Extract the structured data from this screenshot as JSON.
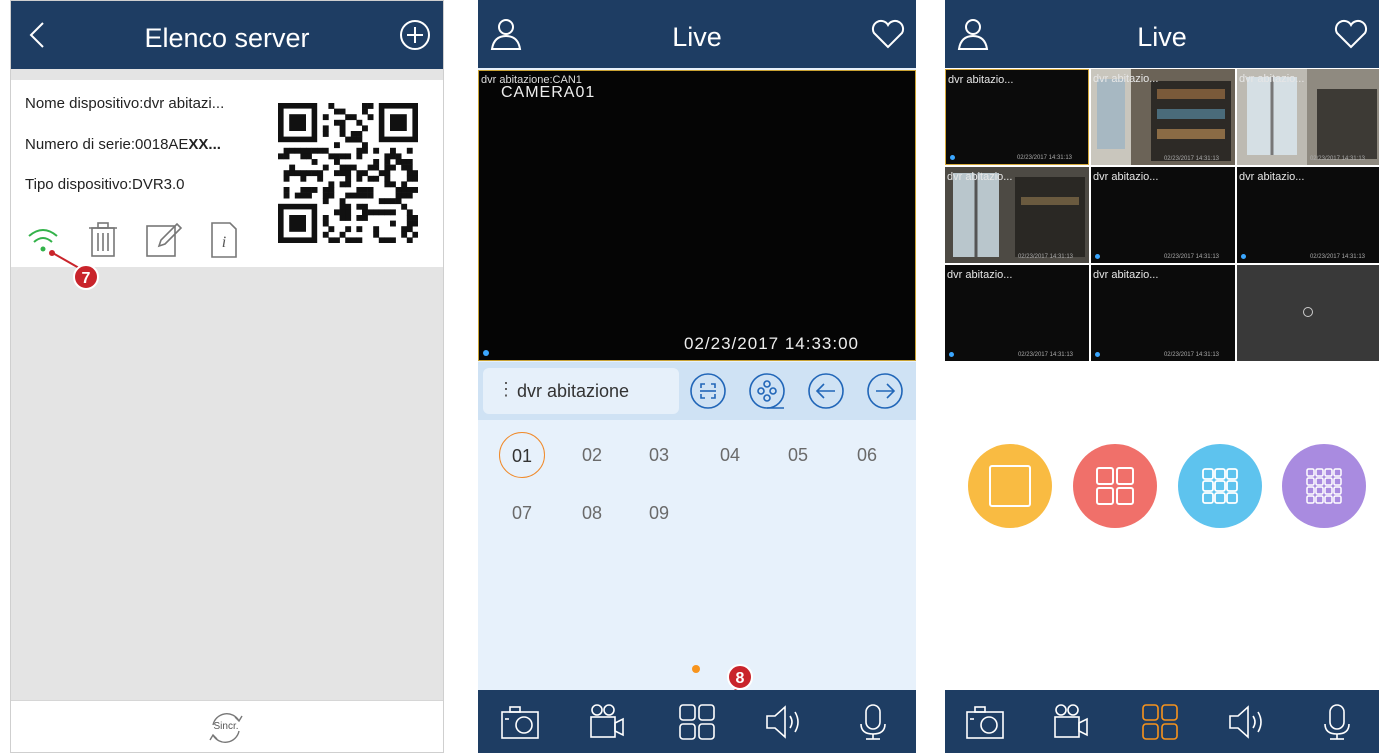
{
  "panel1": {
    "title": "Elenco server",
    "device_name_line": "Nome dispositivo:dvr abitazi...",
    "serial_prefix": "Numero di serie:0018AE",
    "serial_bold": "XX...",
    "type_line": "Tipo dispositivo:DVR3.0",
    "marker": "7",
    "sync_label": "Sincr."
  },
  "panel2": {
    "title": "Live",
    "video_overlay_top": "dvr abitazione:CAN1",
    "video_overlay_camera": "CAMERA01",
    "video_timestamp": "02/23/2017 14:33:00",
    "device_selector": "dvr abitazione",
    "channels": [
      "01",
      "02",
      "03",
      "04",
      "05",
      "06",
      "07",
      "08",
      "09"
    ],
    "selected_channel": "01",
    "marker": "8"
  },
  "panel3": {
    "title": "Live",
    "cells": [
      {
        "label": "dvr abitazio...",
        "ts": "02/23/2017 14:31:13"
      },
      {
        "label": "dvr abitazio...",
        "ts": "02/23/2017 14:31:13"
      },
      {
        "label": "dvr abitazio...",
        "ts": "02/23/2017 14:31:13"
      },
      {
        "label": "dvr abitazio...",
        "ts": "02/23/2017 14:31:13"
      },
      {
        "label": "dvr abitazio...",
        "ts": "02/23/2017 14:31:13"
      },
      {
        "label": "dvr abitazio...",
        "ts": "02/23/2017 14:31:13"
      },
      {
        "label": "dvr abitazio...",
        "ts": "02/23/2017 14:31:13"
      },
      {
        "label": "dvr abitazio...",
        "ts": "02/23/2017 14:31:13"
      },
      {
        "label": "",
        "ts": ""
      }
    ]
  },
  "colors": {
    "header": "#1e3d63",
    "accent_orange": "#f7941d",
    "wifi_green": "#33b24a",
    "layout1": "#f9bb42",
    "layout4": "#f0706a",
    "layout9": "#5ec3ee",
    "layout16": "#a98be0"
  },
  "icons": {
    "panel1_header": [
      "back-icon",
      "add-icon"
    ],
    "panel1_card": [
      "wifi-icon",
      "trash-icon",
      "edit-icon",
      "info-icon"
    ],
    "panel2_header": [
      "user-icon",
      "favorite-icon"
    ],
    "panel2_controls": [
      "scan-icon",
      "reel-icon",
      "prev-icon",
      "next-icon"
    ],
    "bottom_bar": [
      "snapshot-icon",
      "record-icon",
      "layout-grid-icon",
      "audio-icon",
      "talk-icon"
    ]
  }
}
